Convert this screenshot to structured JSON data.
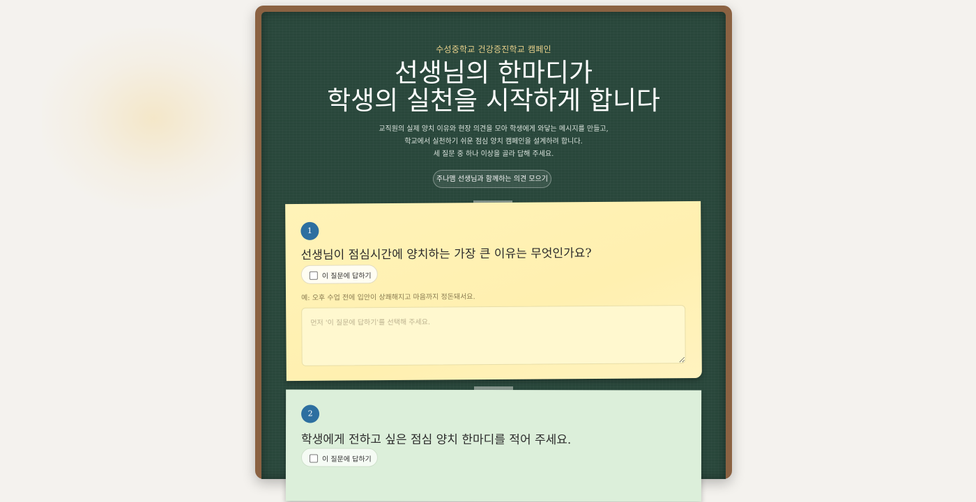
{
  "header": {
    "eyebrow": "수성중학교 건강증진학교 캠페인",
    "title_line1": "선생님의 한마디가",
    "title_line2": "학생의 실천을 시작하게 합니다",
    "desc_line1": "교직원의 실제 양치 이유와 현장 의견을 모아 학생에게 와닿는 메시지를 만들고,",
    "desc_line2": "학교에서 실천하기 쉬운 점심 양치 캠페인을 설계하려 합니다.",
    "desc_line3": "세 질문 중 하나 이상을 골라 답해 주세요.",
    "pill_label": "주나맴 선생님과 함께하는 의견 모으기"
  },
  "questions": [
    {
      "number": "1",
      "text": "선생님이 점심시간에 양치하는 가장 큰 이유는 무엇인가요?",
      "toggle_label": "이 질문에 답하기",
      "hint": "예: 오후 수업 전에 입안이 상쾌해지고 마음까지 정돈돼서요.",
      "placeholder": "먼저 '이 질문에 답하기'를 선택해 주세요.",
      "color": "#fff3b8"
    },
    {
      "number": "2",
      "text": "학생에게 전하고 싶은 점심 양치 한마디를 적어 주세요.",
      "toggle_label": "이 질문에 답하기",
      "color": "#dcefda"
    }
  ],
  "colors": {
    "board": "#29473b",
    "frame": "#8b6242",
    "badge": "#2d6fa0",
    "accent": "#e6cf8a"
  }
}
